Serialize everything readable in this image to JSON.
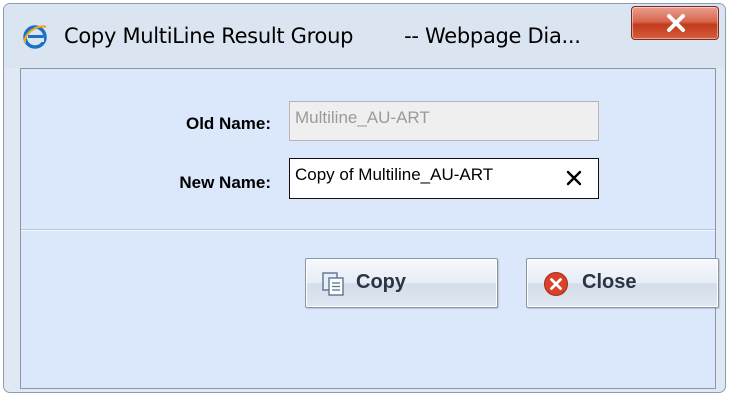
{
  "window": {
    "title": "Copy MultiLine Result Group        -- Webpage Dia...",
    "app_icon": "ie-icon",
    "close_icon": "close-icon"
  },
  "form": {
    "old_name_label": "Old Name:",
    "old_name_value": "Multiline_AU-ART",
    "new_name_label": "New Name:",
    "new_name_value": "Copy of Multiline_AU-ART",
    "clear_icon": "clear-icon"
  },
  "buttons": {
    "copy_label": "Copy",
    "copy_icon": "copy-icon",
    "close_label": "Close",
    "close_icon": "close-circle-icon"
  },
  "colors": {
    "client_bg": "#dbe8fc",
    "titlebar_close": "#c13a1c"
  }
}
